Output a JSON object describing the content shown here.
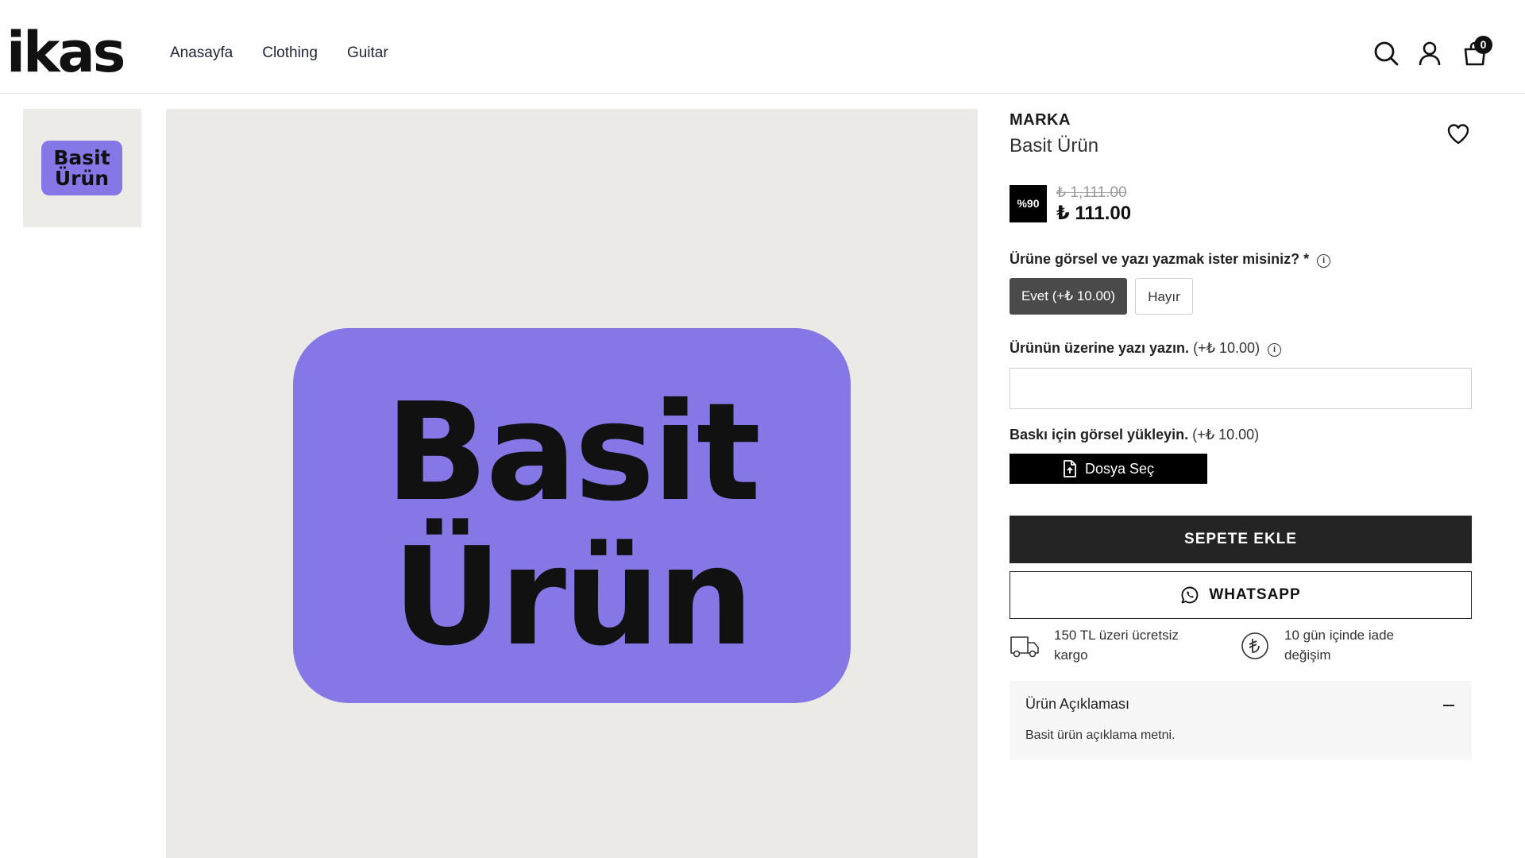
{
  "header": {
    "logo": "ikas",
    "nav": [
      "Anasayfa",
      "Clothing",
      "Guitar"
    ],
    "icons": [
      "search-icon",
      "user-icon",
      "cart-icon"
    ],
    "cart_count": "0"
  },
  "gallery": {
    "thumb_text": [
      "Basit",
      "Ürün"
    ],
    "main_text": [
      "Basit",
      "Ürün"
    ],
    "tag_color": "#8577e6",
    "bg_color": "#eceae6"
  },
  "product": {
    "brand": "MARKA",
    "name": "Basit Ürün",
    "discount_badge": "%90",
    "old_price": "₺ 1,111.00",
    "price": "₺ 111.00"
  },
  "options": {
    "q1_label": "Ürüne görsel ve yazı yazmak ister misiniz? *",
    "yes_label": "Evet (+₺ 10.00)",
    "no_label": "Hayır",
    "q2_label": "Ürünün üzerine yazı yazın.",
    "q2_extra": "(+₺ 10.00)",
    "text_value": "",
    "q3_label": "Baskı için görsel yükleyin.",
    "q3_extra": "(+₺ 10.00)",
    "file_button": "Dosya Seç"
  },
  "actions": {
    "add_to_cart": "SEPETE EKLE",
    "whatsapp": "WHATSAPP"
  },
  "features": [
    {
      "icon": "truck-icon",
      "line1": "150 TL üzeri ücretsiz",
      "line2": "kargo"
    },
    {
      "icon": "lira-icon",
      "line1": "10 gün içinde iade",
      "line2": "değişim"
    }
  ],
  "description": {
    "title": "Ürün Açıklaması",
    "body": "Basit ürün açıklama metni."
  }
}
